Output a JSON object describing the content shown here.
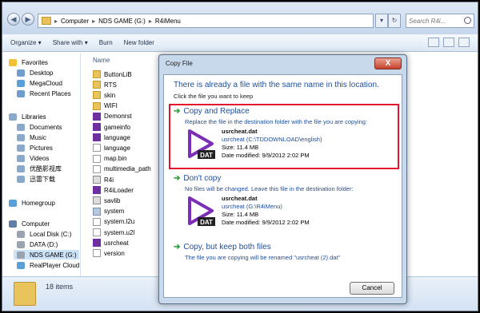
{
  "explorer": {
    "address": [
      "Computer",
      "NDS GAME (G:)",
      "R4iMenu"
    ],
    "search_placeholder": "Search R4i...",
    "toolbar": {
      "organize": "Organize ▾",
      "share": "Share with ▾",
      "burn": "Burn",
      "new_folder": "New folder"
    },
    "sidebar": {
      "favorites": "Favorites",
      "desktop": "Desktop",
      "megacloud": "MegaCloud",
      "recent": "Recent Places",
      "libraries": "Libraries",
      "documents": "Documents",
      "music": "Music",
      "pictures": "Pictures",
      "videos": "Videos",
      "cn1": "优酷影视库",
      "cn2": "迅雷下载",
      "homegroup": "Homegroup",
      "computer": "Computer",
      "local_disk": "Local Disk (C:)",
      "data": "DATA (D:)",
      "nds": "NDS GAME (G:)",
      "realplayer": "RealPlayer Cloud"
    },
    "column_name": "Name",
    "files": [
      {
        "name": "ButtonLiB",
        "icon": "folder"
      },
      {
        "name": "RTS",
        "icon": "folder"
      },
      {
        "name": "skin",
        "icon": "folder"
      },
      {
        "name": "WIFI",
        "icon": "folder"
      },
      {
        "name": "Demonrst",
        "icon": "nds"
      },
      {
        "name": "gameinfo",
        "icon": "nds"
      },
      {
        "name": "language",
        "icon": "nds"
      },
      {
        "name": "language",
        "icon": "doc"
      },
      {
        "name": "map.bin",
        "icon": "doc"
      },
      {
        "name": "multimedia_path",
        "icon": "doc"
      },
      {
        "name": "R4i",
        "icon": "dat"
      },
      {
        "name": "R4iLoader",
        "icon": "nds"
      },
      {
        "name": "savlib",
        "icon": "dat"
      },
      {
        "name": "system",
        "icon": "img"
      },
      {
        "name": "system.l2u",
        "icon": "doc"
      },
      {
        "name": "system.u2l",
        "icon": "doc"
      },
      {
        "name": "usrcheat",
        "icon": "nds"
      },
      {
        "name": "version",
        "icon": "doc"
      }
    ],
    "status": "18 items"
  },
  "dialog": {
    "title": "Copy File",
    "close": "X",
    "heading": "There is already a file with the same name in this location.",
    "subheading": "Click the file you want to keep",
    "option1": {
      "title": "Copy and Replace",
      "desc": "Replace the file in the destination folder with the file you are copying:",
      "filename": "usrcheat.dat",
      "location": "usrcheat (C:\\TDDOWNLOAD\\english)",
      "size": "Size: 11.4 MB",
      "modified": "Date modified: 9/9/2012 2:02 PM"
    },
    "option2": {
      "title": "Don't copy",
      "desc": "No files will be changed. Leave this file in the destination folder:",
      "filename": "usrcheat.dat",
      "location": "usrcheat (G:\\R4iMenu)",
      "size": "Size: 11.4 MB",
      "modified": "Date modified: 9/9/2012 2:02 PM"
    },
    "option3": {
      "title": "Copy, but keep both files",
      "desc": "The file you are copying will be renamed \"usrcheat (2).dat\""
    },
    "dat_label": "DAT",
    "arrow": "➔",
    "cancel": "Cancel"
  }
}
